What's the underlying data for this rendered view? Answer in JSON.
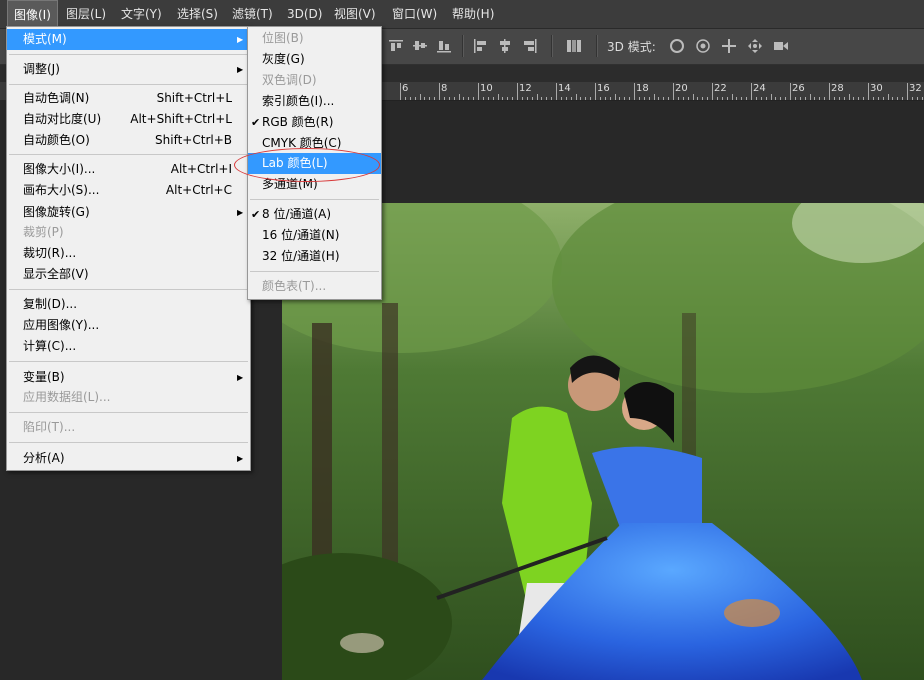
{
  "menubar": {
    "items": [
      "图像(I)",
      "图层(L)",
      "文字(Y)",
      "选择(S)",
      "滤镜(T)",
      "3D(D)",
      "视图(V)",
      "窗口(W)",
      "帮助(H)"
    ]
  },
  "optbar": {
    "mode_3d_label": "3D 模式:"
  },
  "ruler": {
    "labels": [
      "6",
      "8",
      "10",
      "12",
      "14",
      "16",
      "18",
      "20",
      "22",
      "24",
      "26",
      "28",
      "30",
      "32"
    ]
  },
  "image_menu": {
    "mode": "模式(M)",
    "adjust": "调整(J)",
    "auto_tone": "自动色调(N)",
    "auto_tone_sc": "Shift+Ctrl+L",
    "auto_contrast": "自动对比度(U)",
    "auto_contrast_sc": "Alt+Shift+Ctrl+L",
    "auto_color": "自动颜色(O)",
    "auto_color_sc": "Shift+Ctrl+B",
    "image_size": "图像大小(I)...",
    "image_size_sc": "Alt+Ctrl+I",
    "canvas_size": "画布大小(S)...",
    "canvas_size_sc": "Alt+Ctrl+C",
    "rotation": "图像旋转(G)",
    "crop": "裁剪(P)",
    "trim": "裁切(R)...",
    "reveal_all": "显示全部(V)",
    "duplicate": "复制(D)...",
    "apply_image": "应用图像(Y)...",
    "calculations": "计算(C)...",
    "variables": "变量(B)",
    "apply_data": "应用数据组(L)...",
    "trap": "陷印(T)...",
    "analysis": "分析(A)"
  },
  "mode_menu": {
    "bitmap": "位图(B)",
    "grayscale": "灰度(G)",
    "duotone": "双色调(D)",
    "indexed": "索引颜色(I)...",
    "rgb": "RGB 颜色(R)",
    "cmyk": "CMYK 颜色(C)",
    "lab": "Lab 颜色(L)",
    "multichannel": "多通道(M)",
    "bit8": "8 位/通道(A)",
    "bit16": "16 位/通道(N)",
    "bit32": "32 位/通道(H)",
    "color_table": "颜色表(T)..."
  }
}
